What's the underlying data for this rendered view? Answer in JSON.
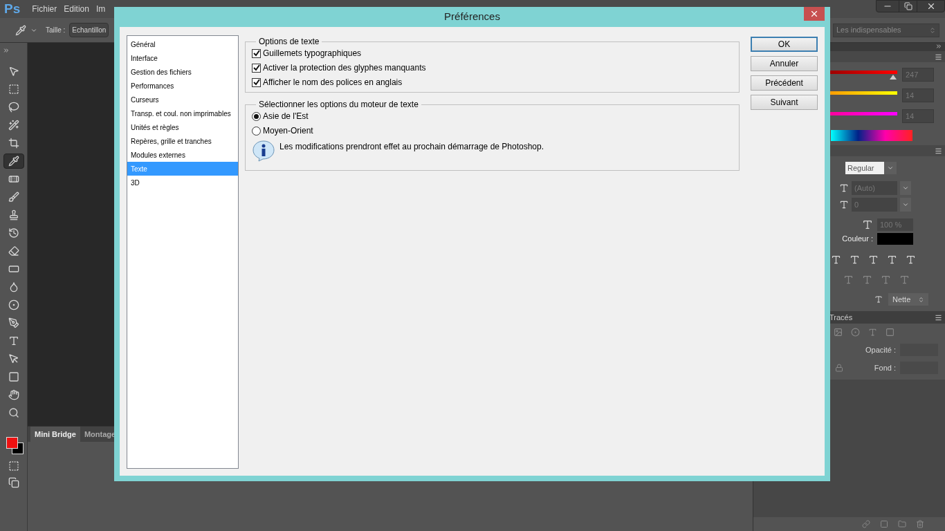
{
  "app": {
    "logo": "Ps",
    "menu": [
      "Fichier",
      "Edition",
      "Im"
    ]
  },
  "options_bar": {
    "size_label": "Taille :",
    "size_value": "Echantillon",
    "workspace": "Les indispensables"
  },
  "tools": [
    {
      "kind": "move",
      "selected": false
    },
    {
      "kind": "marquee",
      "selected": false
    },
    {
      "kind": "lasso",
      "selected": false
    },
    {
      "kind": "quick-select",
      "selected": false
    },
    {
      "kind": "crop",
      "selected": false
    },
    {
      "kind": "eyedropper",
      "selected": true
    },
    {
      "kind": "healing",
      "selected": false
    },
    {
      "kind": "brush",
      "selected": false
    },
    {
      "kind": "stamp",
      "selected": false
    },
    {
      "kind": "history",
      "selected": false
    },
    {
      "kind": "eraser",
      "selected": false
    },
    {
      "kind": "gradient",
      "selected": false
    },
    {
      "kind": "blur",
      "selected": false
    },
    {
      "kind": "dodge",
      "selected": false
    },
    {
      "kind": "pen",
      "selected": false
    },
    {
      "kind": "type",
      "selected": false
    },
    {
      "kind": "path-select",
      "selected": false
    },
    {
      "kind": "shape",
      "selected": false
    },
    {
      "kind": "hand",
      "selected": false
    },
    {
      "kind": "zoom",
      "selected": false
    }
  ],
  "bottom_panel": {
    "tabs": [
      {
        "label": "Mini Bridge",
        "selected": true
      },
      {
        "label": "Montage",
        "selected": false
      }
    ]
  },
  "color_panel": {
    "sliders": [
      {
        "value": "247",
        "level": 0.97
      },
      {
        "value": "14",
        "level": 0.05
      },
      {
        "value": "14",
        "level": 0.05
      }
    ]
  },
  "character_panel": {
    "style": "Regular",
    "leading": "(Auto)",
    "tracking": "0",
    "scale": "100 %",
    "color_label": "Couleur :",
    "antialias": "Nette"
  },
  "layers_panel": {
    "tab": "Tracés",
    "opacity_label": "Opacité :",
    "fill_label": "Fond :"
  },
  "dialog": {
    "title": "Préférences",
    "categories": [
      {
        "label": "Général",
        "selected": false
      },
      {
        "label": "Interface",
        "selected": false
      },
      {
        "label": "Gestion des fichiers",
        "selected": false
      },
      {
        "label": "Performances",
        "selected": false
      },
      {
        "label": "Curseurs",
        "selected": false
      },
      {
        "label": "Transp. et coul. non imprimables",
        "selected": false
      },
      {
        "label": "Unités et règles",
        "selected": false
      },
      {
        "label": "Repères, grille et tranches",
        "selected": false
      },
      {
        "label": "Modules externes",
        "selected": false
      },
      {
        "label": "Texte",
        "selected": true
      },
      {
        "label": "3D",
        "selected": false
      }
    ],
    "groups": [
      {
        "title": "Options de texte",
        "items": [
          {
            "kind": "checkbox",
            "label": "Guillemets typographiques",
            "checked": true
          },
          {
            "kind": "checkbox",
            "label": "Activer la protection des glyphes manquants",
            "checked": true
          },
          {
            "kind": "checkbox",
            "label": "Afficher le nom des polices en anglais",
            "checked": true
          }
        ]
      },
      {
        "title": "Sélectionner les options du moteur de texte",
        "items": [
          {
            "kind": "radio",
            "label": "Asie de l'Est",
            "selected": true
          },
          {
            "kind": "radio",
            "label": "Moyen-Orient",
            "selected": false
          },
          {
            "kind": "info",
            "label": "Les modifications prendront effet au prochain démarrage de Photoshop."
          }
        ]
      }
    ],
    "buttons": [
      {
        "label": "OK",
        "default": true
      },
      {
        "label": "Annuler",
        "default": false
      },
      {
        "label": "Précédent",
        "default": false
      },
      {
        "label": "Suivant",
        "default": false
      }
    ]
  }
}
